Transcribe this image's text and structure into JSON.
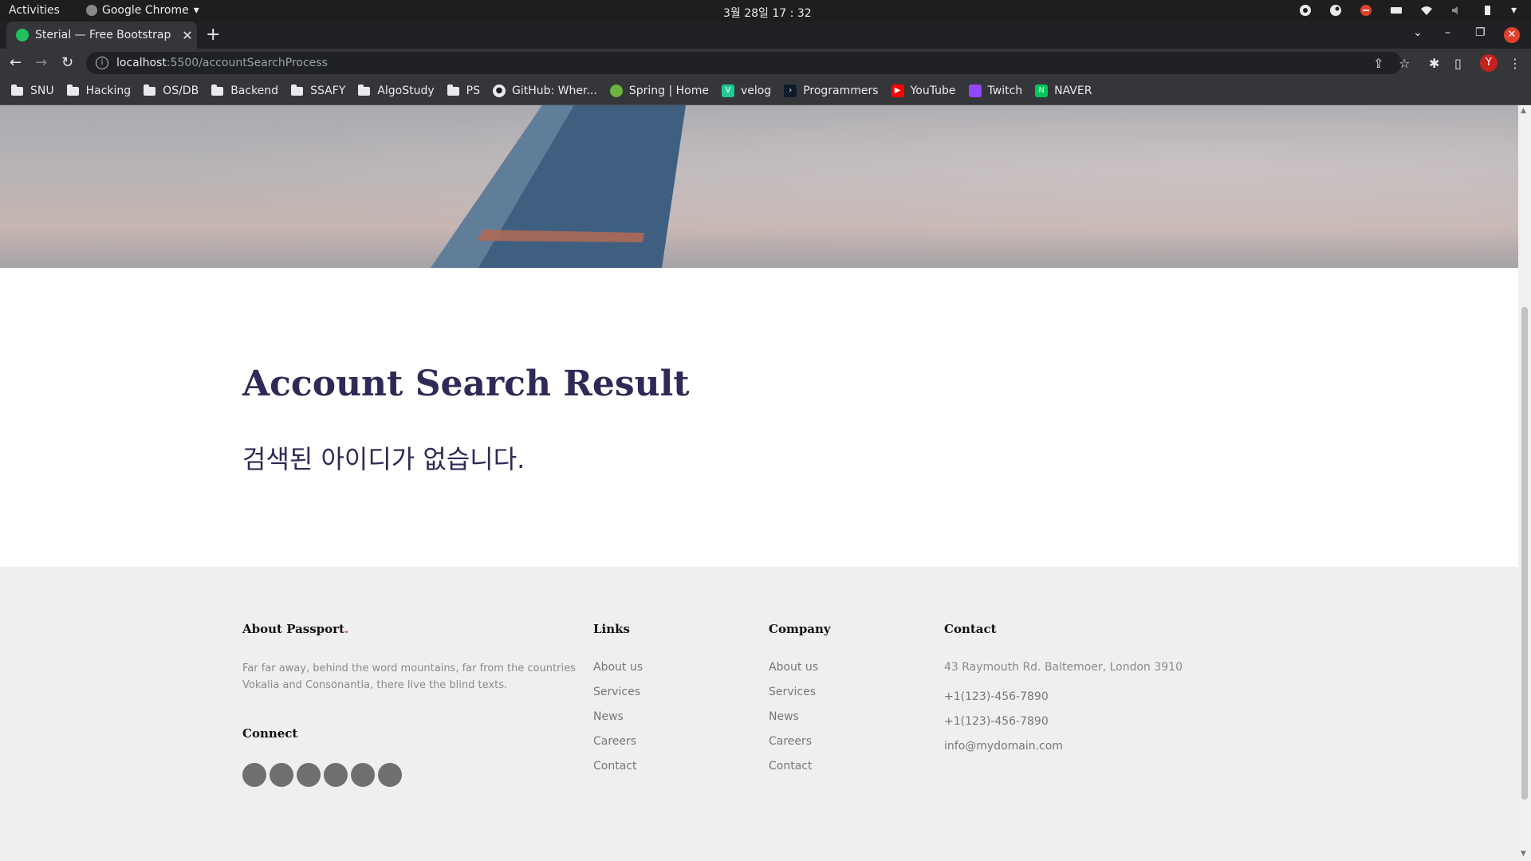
{
  "system": {
    "activities": "Activities",
    "app_name": "Google Chrome",
    "clock": "3월 28일  17 : 32"
  },
  "browser": {
    "tab_title": "Sterial — Free Bootstrap",
    "url_host": "localhost",
    "url_path": ":5500/accountSearchProcess",
    "avatar_letter": "Y",
    "bookmarks": [
      {
        "label": "SNU",
        "icon": "folder-icon"
      },
      {
        "label": "Hacking",
        "icon": "folder-icon"
      },
      {
        "label": "OS/DB",
        "icon": "folder-icon"
      },
      {
        "label": "Backend",
        "icon": "folder-icon"
      },
      {
        "label": "SSAFY",
        "icon": "folder-icon"
      },
      {
        "label": "AlgoStudy",
        "icon": "folder-icon"
      },
      {
        "label": "PS",
        "icon": "folder-icon"
      },
      {
        "label": "GitHub: Wher...",
        "icon": "github-icon"
      },
      {
        "label": "Spring | Home",
        "icon": "spring-icon"
      },
      {
        "label": "velog",
        "icon": "velog-icon"
      },
      {
        "label": "Programmers",
        "icon": "programmers-icon"
      },
      {
        "label": "YouTube",
        "icon": "youtube-icon"
      },
      {
        "label": "Twitch",
        "icon": "twitch-icon"
      },
      {
        "label": "NAVER",
        "icon": "naver-icon"
      }
    ]
  },
  "page": {
    "title": "Account Search Result",
    "message": "검색된 아이디가 없습니다."
  },
  "footer": {
    "about": {
      "heading": "About Passport",
      "heading_dot": ".",
      "text": "Far far away, behind the word mountains, far from the countries Vokalia and Consonantia, there live the blind texts."
    },
    "connect": {
      "heading": "Connect",
      "social_count_note": "6"
    },
    "links": {
      "heading": "Links",
      "items": [
        "About us",
        "Services",
        "News",
        "Careers",
        "Contact"
      ]
    },
    "company": {
      "heading": "Company",
      "items": [
        "About us",
        "Services",
        "News",
        "Careers",
        "Contact"
      ]
    },
    "contact": {
      "heading": "Contact",
      "address": "43 Raymouth Rd. Baltemoer, London 3910",
      "phone1": "+1(123)-456-7890",
      "phone2": "+1(123)-456-7890",
      "email": "info@mydomain.com"
    }
  },
  "colors": {
    "heading": "#2e2a57",
    "footer_bg": "#efefef",
    "accent_dot": "#e0413b"
  }
}
